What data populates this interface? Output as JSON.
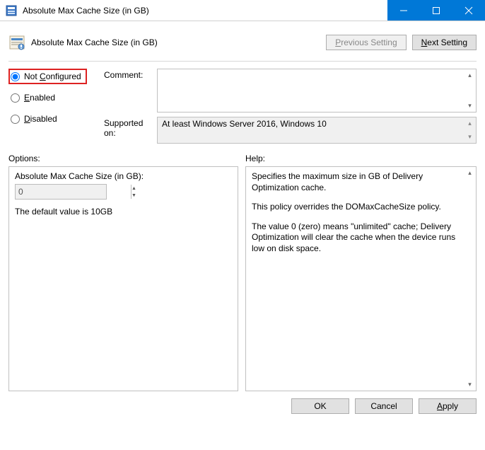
{
  "window": {
    "title": "Absolute Max Cache Size (in GB)"
  },
  "header": {
    "title": "Absolute Max Cache Size (in GB)",
    "previous_btn": "Previous Setting",
    "next_btn": "Next Setting"
  },
  "radios": {
    "not_configured": "Not Configured",
    "enabled": "Enabled",
    "disabled": "Disabled"
  },
  "labels": {
    "comment": "Comment:",
    "supported": "Supported on:",
    "options": "Options:",
    "help": "Help:"
  },
  "supported_text": "At least Windows Server 2016, Windows 10",
  "options": {
    "field_label": "Absolute Max Cache Size (in GB):",
    "field_value": "0",
    "note": "The default value is 10GB"
  },
  "help": {
    "p1": "Specifies the maximum size in GB of Delivery Optimization cache.",
    "p2": "This policy overrides the DOMaxCacheSize policy.",
    "p3": "The value 0 (zero) means \"unlimited\" cache; Delivery Optimization will clear the cache when the device runs low on disk space."
  },
  "footer": {
    "ok": "OK",
    "cancel": "Cancel",
    "apply": "Apply"
  }
}
